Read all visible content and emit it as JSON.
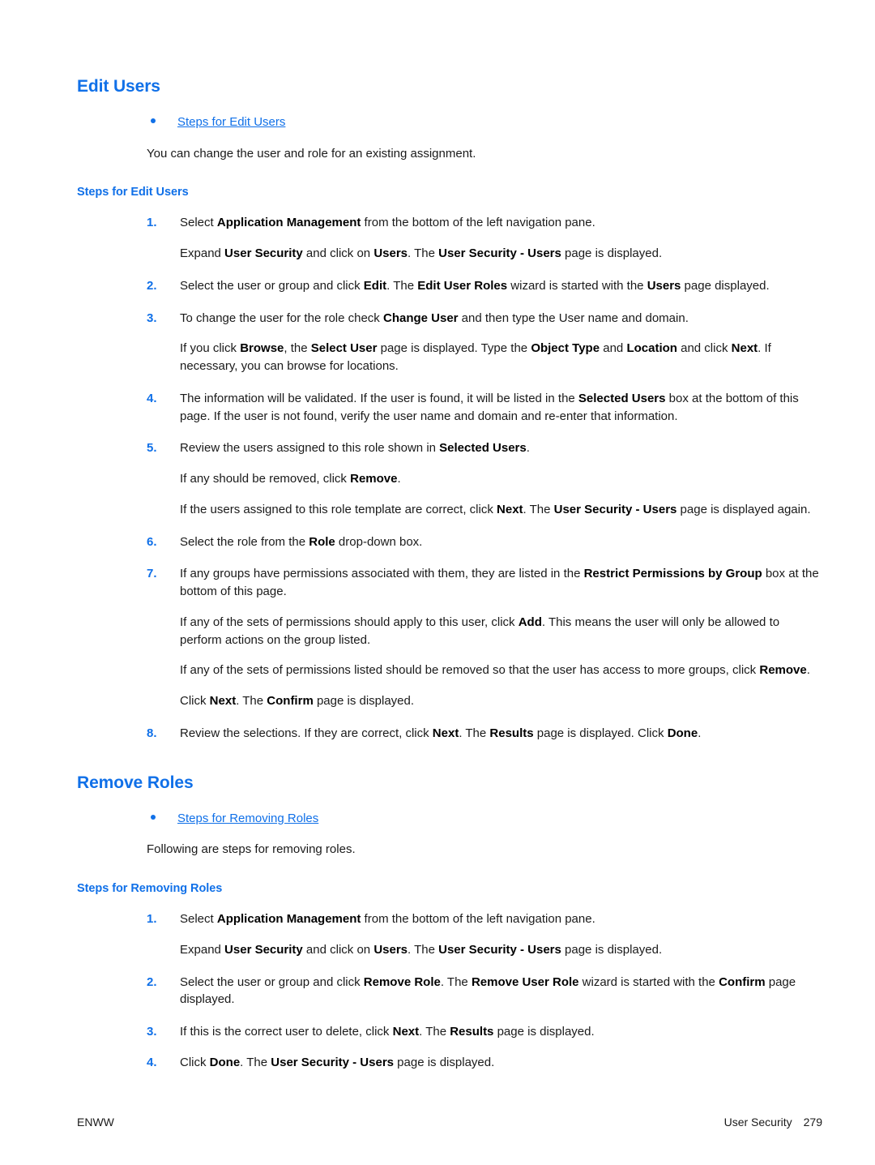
{
  "document": {
    "sections": [
      {
        "id": "edit-users",
        "heading": "Edit Users",
        "xref_bullet": "Steps for Edit Users",
        "intro": "You can change the user and role for an existing assignment.",
        "sub_heading": "Steps for Edit Users",
        "steps": [
          {
            "number": "1.",
            "paragraphs": [
              "Select <b>Application Management</b> from the bottom of the left navigation pane.",
              "Expand <b>User Security</b> and click on <b>Users</b>. The <b>User Security - Users</b> page is displayed."
            ]
          },
          {
            "number": "2.",
            "paragraphs": [
              "Select the user or group and click <b>Edit</b>. The <b>Edit User Roles</b> wizard is started with the <b>Users</b> page displayed."
            ]
          },
          {
            "number": "3.",
            "paragraphs": [
              "To change the user for the role check <b>Change User</b> and then type the User name and domain.",
              "If you click <b>Browse</b>, the <b>Select User</b> page is displayed. Type the <b>Object Type</b> and <b>Location</b> and click <b>Next</b>. If necessary, you can browse for locations."
            ]
          },
          {
            "number": "4.",
            "paragraphs": [
              "The information will be validated. If the user is found, it will be listed in the <b>Selected Users</b> box at the bottom of this page. If the user is not found, verify the user name and domain and re-enter that information."
            ]
          },
          {
            "number": "5.",
            "paragraphs": [
              "Review the users assigned to this role shown in <b>Selected Users</b>.",
              "If any should be removed, click <b>Remove</b>.",
              "If the users assigned to this role template are correct, click <b>Next</b>. The <b>User Security - Users</b> page is displayed again."
            ]
          },
          {
            "number": "6.",
            "paragraphs": [
              "Select the role from the <b>Role</b> drop-down box."
            ]
          },
          {
            "number": "7.",
            "paragraphs": [
              "If any groups have permissions associated with them, they are listed in the <b>Restrict Permissions by Group</b> box at the bottom of this page.",
              "If any of the sets of permissions should apply to this user, click <b>Add</b>. This means the user will only be allowed to perform actions on the group listed.",
              "If any of the sets of permissions listed should be removed so that the user has access to more groups, click <b>Remove</b>.",
              "Click <b>Next</b>. The <b>Confirm</b> page is displayed."
            ]
          },
          {
            "number": "8.",
            "paragraphs": [
              "Review the selections. If they are correct, click <b>Next</b>. The <b>Results</b> page is displayed. Click <b>Done</b>."
            ]
          }
        ]
      },
      {
        "id": "remove-roles",
        "heading": "Remove Roles",
        "xref_bullet": "Steps for Removing Roles",
        "intro": "Following are steps for removing roles.",
        "sub_heading": "Steps for Removing Roles",
        "steps": [
          {
            "number": "1.",
            "paragraphs": [
              "Select <b>Application Management</b> from the bottom of the left navigation pane.",
              "Expand <b>User Security</b> and click on <b>Users</b>. The <b>User Security - Users</b> page is displayed."
            ]
          },
          {
            "number": "2.",
            "paragraphs": [
              "Select the user or group and click <b>Remove Role</b>. The <b>Remove User Role</b> wizard is started with the <b>Confirm</b> page displayed."
            ]
          },
          {
            "number": "3.",
            "paragraphs": [
              "If this is the correct user to delete, click <b>Next</b>. The <b>Results</b> page is displayed."
            ]
          },
          {
            "number": "4.",
            "paragraphs": [
              "Click <b>Done</b>. The <b>User Security - Users</b> page is displayed."
            ]
          }
        ]
      }
    ]
  },
  "footer": {
    "left": "ENWW",
    "chapter": "User Security",
    "page_number": "279"
  },
  "colors": {
    "heading_blue": "#1070e8",
    "link_blue": "#1070e8",
    "body_text": "#1a1a1a"
  }
}
